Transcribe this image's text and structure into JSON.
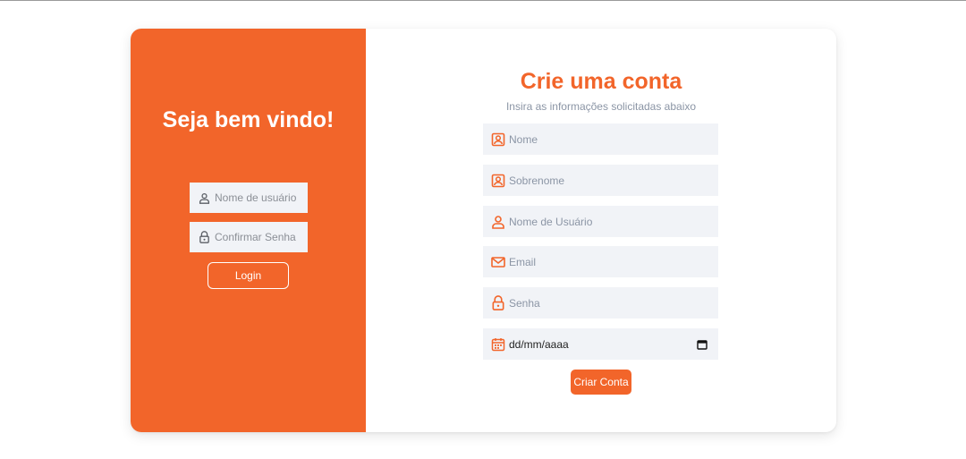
{
  "colors": {
    "accent": "#f2652a",
    "field_bg": "#f1f3f7",
    "muted_text": "#8b95a5"
  },
  "left_panel": {
    "title": "Seja bem vindo!",
    "username": {
      "placeholder": "Nome de usuário",
      "icon": "user-icon"
    },
    "password": {
      "placeholder": "Confirmar Senha",
      "icon": "lock-icon"
    },
    "login_label": "Login"
  },
  "right_panel": {
    "title": "Crie uma conta",
    "subtitle": "Insira as informações solicitadas abaixo",
    "fields": [
      {
        "placeholder": "Nome",
        "icon": "id-badge-icon"
      },
      {
        "placeholder": "Sobrenome",
        "icon": "id-badge-icon"
      },
      {
        "placeholder": "Nome de Usuário",
        "icon": "user-icon"
      },
      {
        "placeholder": "Email",
        "icon": "envelope-icon"
      },
      {
        "placeholder": "Senha",
        "icon": "lock-icon"
      }
    ],
    "date": {
      "value": "dd/mm/aaaa",
      "icon": "calendar-icon"
    },
    "create_label": "Criar Conta"
  }
}
